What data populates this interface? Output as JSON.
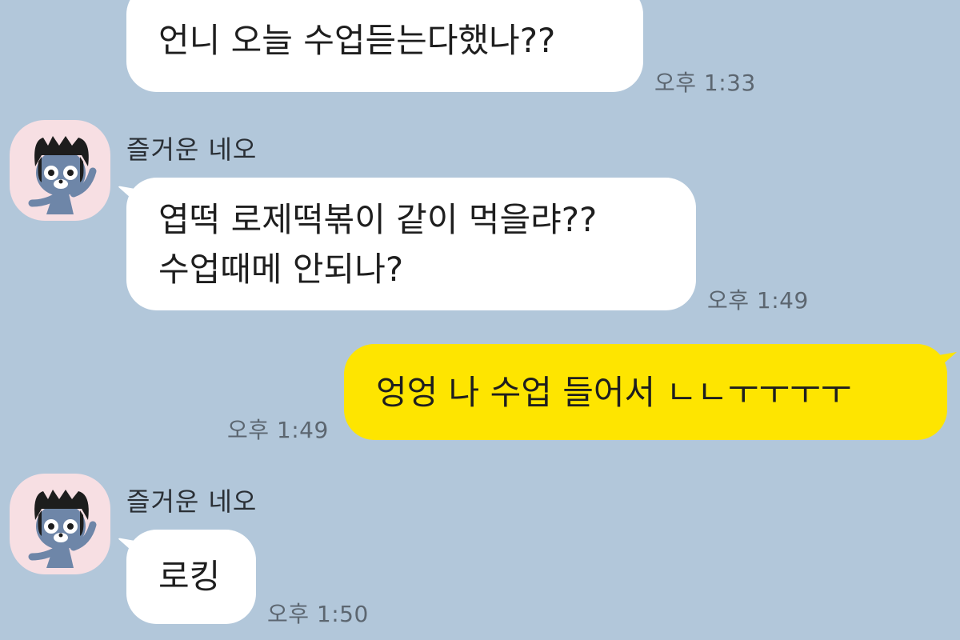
{
  "messages": [
    {
      "direction": "incoming",
      "lines": [
        "언니 오늘 수업듣는다했나??"
      ],
      "time": "오후 1:33"
    },
    {
      "direction": "incoming",
      "sender": "즐거운 네오",
      "avatar_icon": "neo-character-avatar-icon",
      "lines": [
        "엽떡 로제떡볶이 같이 먹을랴??",
        "수업때메 안되나?"
      ],
      "time": "오후 1:49"
    },
    {
      "direction": "outgoing",
      "lines": [
        "엉엉 나 수업 들어서 ㄴㄴㅜㅜㅜㅜ"
      ],
      "time": "오후 1:49"
    },
    {
      "direction": "incoming",
      "sender": "즐거운 네오",
      "avatar_icon": "neo-character-avatar-icon",
      "lines": [
        "로킹"
      ],
      "time": "오후 1:50"
    }
  ],
  "colors": {
    "background": "#b2c7da",
    "incoming_bubble": "#ffffff",
    "outgoing_bubble": "#fee500",
    "avatar_background": "#f7dfe3",
    "timestamp_text": "#5c6670"
  }
}
